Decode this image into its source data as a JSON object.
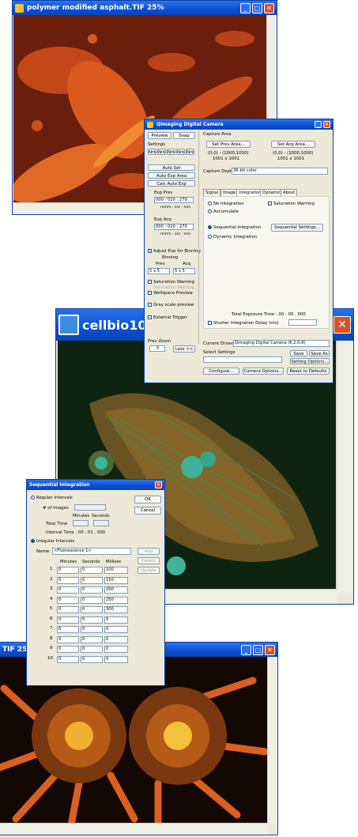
{
  "win_asphalt": {
    "title": "polymer modified asphalt.TIF 25%"
  },
  "win_cell": {
    "title": "cellbio10g"
  },
  "win_urchin": {
    "title": "TIF 25%"
  },
  "camera": {
    "title": "Qimaging Digital Camera",
    "preview": "Preview",
    "snap": "Snap",
    "settings": "Settings",
    "bin_labels": [
      "Nrk",
      "Nrk",
      "Nrk",
      "Nrk",
      "Nrk"
    ],
    "auto_set": "Auto Set",
    "auto_exp_area": "Auto Exp Area",
    "calc_auto_exp": "Calc Auto Exp",
    "exp_prev": "Exp Prev",
    "exp_prev_val": "000 : 010 : 270",
    "exp_prev_units": "mmm : sss : nnn",
    "exp_acq": "Exp Acq",
    "exp_acq_val": "000 : 010 : 270",
    "exp_acq_units": "mmm : sss : nnn",
    "adjust_exp": "Adjust Exp for Binning",
    "binning": "Binning",
    "prev": "Prev",
    "acq": "Acq",
    "bin_prev": "5 x 5",
    "bin_acq": "5 x 5",
    "saturation_warning": "Saturation Warning",
    "saturation_sub": "Saturation Warning",
    "wellspace_preview": "Wellspace Preview",
    "gray_scale": "Gray scale preview",
    "external_trigger": "External Trigger",
    "prev_zoom": "Prev Zoom",
    "zoom_val": "0",
    "less": "Less <<",
    "capture_area": "Capture Area",
    "set_prev_area": "Set Prev Area...",
    "set_acq_area": "Set Acq Area...",
    "prev_coords": "(0,0) - (1000,1000)",
    "prev_size": "1001 x 1001",
    "acq_coords": "(0,0) - (1000,1000)",
    "acq_size": "1001 x 1001",
    "capture_depth": "Capture Depth",
    "depth_val": "36-bit color",
    "tabs": [
      "Signal",
      "Image",
      "Integration",
      "Dynamic",
      "About"
    ],
    "no_integration": "No Integration",
    "accumulate": "Accumulate",
    "sequential_integration": "Sequential Integration",
    "dynamic_integration": "Dynamic Integration",
    "saturation_warning2": "Saturation Warning",
    "sequential_settings": "Sequential Settings...",
    "total_exposure": "Total Exposure Time :  00 : 00 . 000",
    "shutter_delay": "Shutter Integration Delay (ms)",
    "current_driver": "Current Driver",
    "driver_val": "Qimaging Digital Camera (6.2.0.8)",
    "select_settings": "Select Settings",
    "save": "Save",
    "save_as": "Save As",
    "setting_options": "Setting Options...",
    "configure": "Configure...",
    "camera_options": "Camera Options...",
    "reset_defaults": "Reset to Defaults"
  },
  "seq": {
    "title": "Sequential Integration",
    "regular_intervals": "Regular Intervals",
    "num_images": "# of Images",
    "minutes": "Minutes",
    "seconds": "Seconds",
    "total_time": "Total Time",
    "interval_time": "Interval Time :  00 : 01 . 000",
    "irregular_intervals": "Irregular Intervals",
    "name": "Name:",
    "name_val": "<Fluorescence 1>",
    "ok": "OK",
    "cancel": "Cancel",
    "add": "Add",
    "delete": "Delete",
    "update": "Update",
    "col_minutes": "Minutes",
    "col_seconds": "Seconds",
    "col_millisec": "Millisec",
    "rows": [
      {
        "n": "1",
        "m": "0",
        "s": "0",
        "ms": "100"
      },
      {
        "n": "2",
        "m": "0",
        "s": "0",
        "ms": "150"
      },
      {
        "n": "3",
        "m": "0",
        "s": "0",
        "ms": "200"
      },
      {
        "n": "4",
        "m": "0",
        "s": "0",
        "ms": "250"
      },
      {
        "n": "5",
        "m": "0",
        "s": "0",
        "ms": "300"
      },
      {
        "n": "6",
        "m": "0",
        "s": "0",
        "ms": "0"
      },
      {
        "n": "7",
        "m": "0",
        "s": "0",
        "ms": "0"
      },
      {
        "n": "8",
        "m": "0",
        "s": "0",
        "ms": "0"
      },
      {
        "n": "9",
        "m": "0",
        "s": "0",
        "ms": "0"
      },
      {
        "n": "10",
        "m": "0",
        "s": "0",
        "ms": "0"
      }
    ]
  }
}
